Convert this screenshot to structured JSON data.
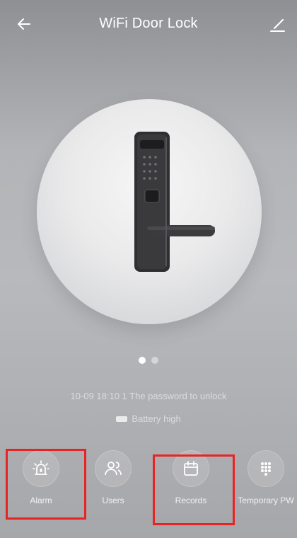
{
  "header": {
    "title": "WiFi Door Lock"
  },
  "status": {
    "last_record": "10-09 18:10 1 The password to unlock",
    "battery": "Battery high"
  },
  "pager": {
    "count": 2,
    "active_index": 0
  },
  "actions": [
    {
      "label": "Alarm",
      "icon": "alarm-icon"
    },
    {
      "label": "Users",
      "icon": "users-icon"
    },
    {
      "label": "Records",
      "icon": "calendar-icon"
    },
    {
      "label": "Temporary PW",
      "icon": "keypad-icon"
    }
  ],
  "colors": {
    "highlight": "#e82323",
    "lock_body": "#2f2f31"
  }
}
